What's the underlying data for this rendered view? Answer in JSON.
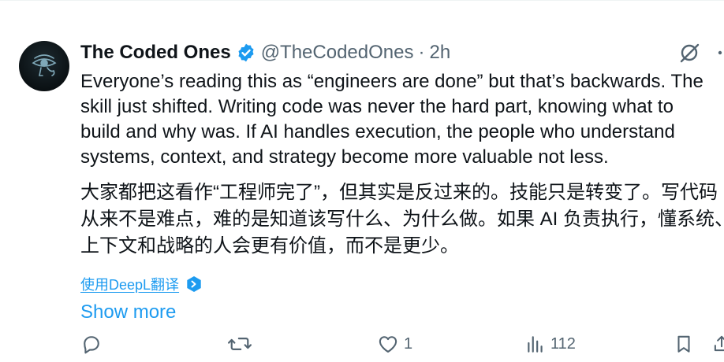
{
  "author": {
    "name": "The Coded Ones",
    "handle": "@TheCodedOnes",
    "separator": "·",
    "time": "2h",
    "verified": true,
    "avatar_icon": "eye-of-horus-logo"
  },
  "tweet": {
    "lines": [
      "Everyone’s reading this as “engineers are done” but that’s backwards. The",
      "skill just shifted. Writing code was never the hard part, knowing what to",
      "build and why was. If AI handles execution, the people who understand",
      "systems, context, and strategy become more valuable not less."
    ],
    "translated_lines": [
      "大家都把这看作“工程师完了”，但其实是反过来的。技能只是转变了。写代码",
      "从来不是难点，难的是知道该写什么、为什么做。如果 AI 负责执行，懂系统、",
      "上下文和战略的人会更有价值，而不是更少。"
    ],
    "translate_label": "使用DeepL翻译",
    "show_more": "Show more"
  },
  "actions": {
    "reply": {
      "icon": "reply-icon",
      "count": ""
    },
    "retweet": {
      "icon": "retweet-icon",
      "count": ""
    },
    "like": {
      "icon": "heart-icon",
      "count": "1"
    },
    "views": {
      "icon": "views-icon",
      "count": "112"
    },
    "bookmark": {
      "icon": "bookmark-icon"
    },
    "share": {
      "icon": "share-icon"
    }
  },
  "header_actions": {
    "grok": {
      "icon": "grok-icon"
    },
    "more": {
      "icon": "more-icon"
    }
  },
  "colors": {
    "text": "#0f1419",
    "muted": "#536471",
    "accent": "#1d9bf0"
  }
}
